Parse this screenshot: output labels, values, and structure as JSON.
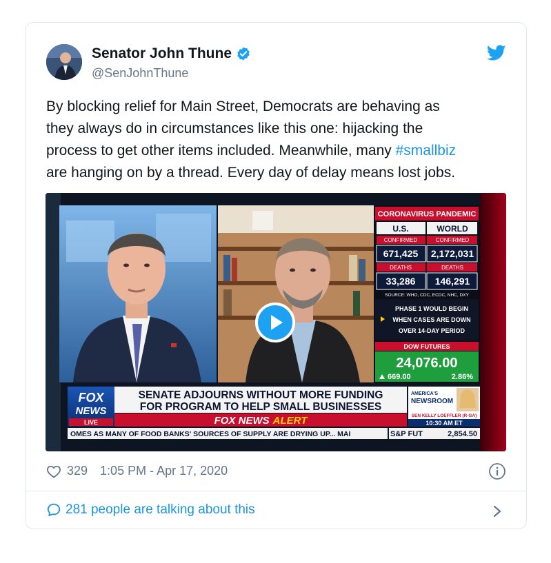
{
  "tweet": {
    "author_name": "Senator John Thune",
    "handle": "@SenJohnThune",
    "text_lines": [
      "By blocking relief for Main Street, Democrats are behaving as",
      "they always do in circumstances like this one: hijacking the",
      "process to get other items included. Meanwhile, many ",
      "are hanging on by a thread. Every day of delay means lost jobs."
    ],
    "hashtag": "#smallbiz",
    "likes": "329",
    "timestamp": "1:05 PM - Apr 17, 2020",
    "talking": "281 people are talking about this"
  },
  "video": {
    "panel_title": "CORONAVIRUS PANDEMIC",
    "us_label": "U.S.",
    "world_label": "WORLD",
    "confirmed_label": "CONFIRMED",
    "us_confirmed": "671,425",
    "world_confirmed": "2,172,031",
    "deaths_label": "DEATHS",
    "us_deaths": "33,286",
    "world_deaths": "146,291",
    "source": "SOURCE: WHO, CDC, ECDC, NHC, DXY",
    "phase_line1": "PHASE 1 WOULD BEGIN",
    "phase_line2": "WHEN CASES ARE DOWN",
    "phase_line3": "OVER 14-DAY PERIOD",
    "dow_label": "DOW FUTURES",
    "dow_value": "24,076.00",
    "dow_change": "669.00",
    "dow_pct": "2.86%",
    "headline1": "SENATE ADJOURNS WITHOUT MORE FUNDING",
    "headline2": "FOR PROGRAM TO HELP SMALL BUSINESSES",
    "alert_fox": "FOX NEWS",
    "alert_word": "ALERT",
    "logo_fox": "FOX",
    "logo_news": "NEWS",
    "logo_live": "LIVE",
    "show_name1": "AMERICA'S",
    "show_name2": "NEWSROOM",
    "guest": "SEN KELLY LOEFFLER (R-GA)",
    "show_time": "10:30 AM ET",
    "ticker": "OMES AS MANY OF FOOD BANKS' SOURCES OF SUPPLY ARE DRYING UP...  MAI",
    "sp_label": "S&P FUT",
    "sp_value": "2,854.50"
  },
  "colors": {
    "link": "#1b95e0",
    "text": "#14171a",
    "secondary": "#657786",
    "fox_red": "#c8102e",
    "fox_blue": "#003a8c",
    "alert_yellow": "#ffd200",
    "dow_green": "#1f9e3d"
  }
}
